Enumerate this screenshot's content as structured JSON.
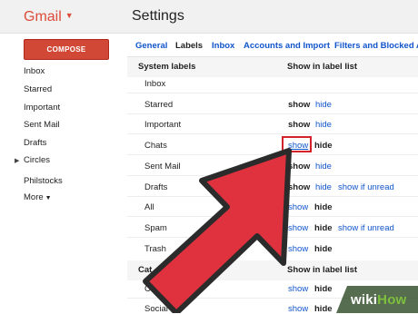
{
  "header": {
    "brand": "Gmail",
    "page_title": "Settings"
  },
  "compose": {
    "label": "COMPOSE"
  },
  "sidebar": {
    "items": [
      "Inbox",
      "Starred",
      "Important",
      "Sent Mail",
      "Drafts",
      "Circles",
      "Philstocks",
      "More"
    ]
  },
  "tabs": [
    "General",
    "Labels",
    "Inbox",
    "Accounts and Import",
    "Filters and Blocked A"
  ],
  "system_labels": {
    "header": "System labels",
    "col_header": "Show in label list",
    "rows": [
      {
        "label": "Inbox",
        "show": "",
        "hide": "",
        "extra": ""
      },
      {
        "label": "Starred",
        "show": "show",
        "hide": "hide",
        "extra": ""
      },
      {
        "label": "Important",
        "show": "show",
        "hide": "hide",
        "extra": ""
      },
      {
        "label": "Chats",
        "show": "show",
        "hide": "hide",
        "extra": ""
      },
      {
        "label": "Sent Mail",
        "show": "show",
        "hide": "hide",
        "extra": ""
      },
      {
        "label": "Drafts",
        "show": "show",
        "hide": "hide",
        "extra": "show if unread"
      },
      {
        "label": "All",
        "show": "show",
        "hide": "hide",
        "extra": ""
      },
      {
        "label": "Spam",
        "show": "show",
        "hide": "hide",
        "extra": "show if unread"
      },
      {
        "label": "Trash",
        "show": "show",
        "hide": "hide",
        "extra": ""
      }
    ]
  },
  "categories": {
    "header": "Cat",
    "col_header": "Show in label list",
    "rows": [
      {
        "label": "Categories",
        "show": "show",
        "hide": "hide"
      },
      {
        "label": "Social",
        "show": "show",
        "hide": "hide"
      }
    ]
  },
  "watermark": {
    "part1": "wiki",
    "part2": "How"
  },
  "colors": {
    "gmail_red": "#dd4b39",
    "link_blue": "#15c",
    "highlight_red": "#d2232a",
    "arrow_red": "#e0323e"
  }
}
